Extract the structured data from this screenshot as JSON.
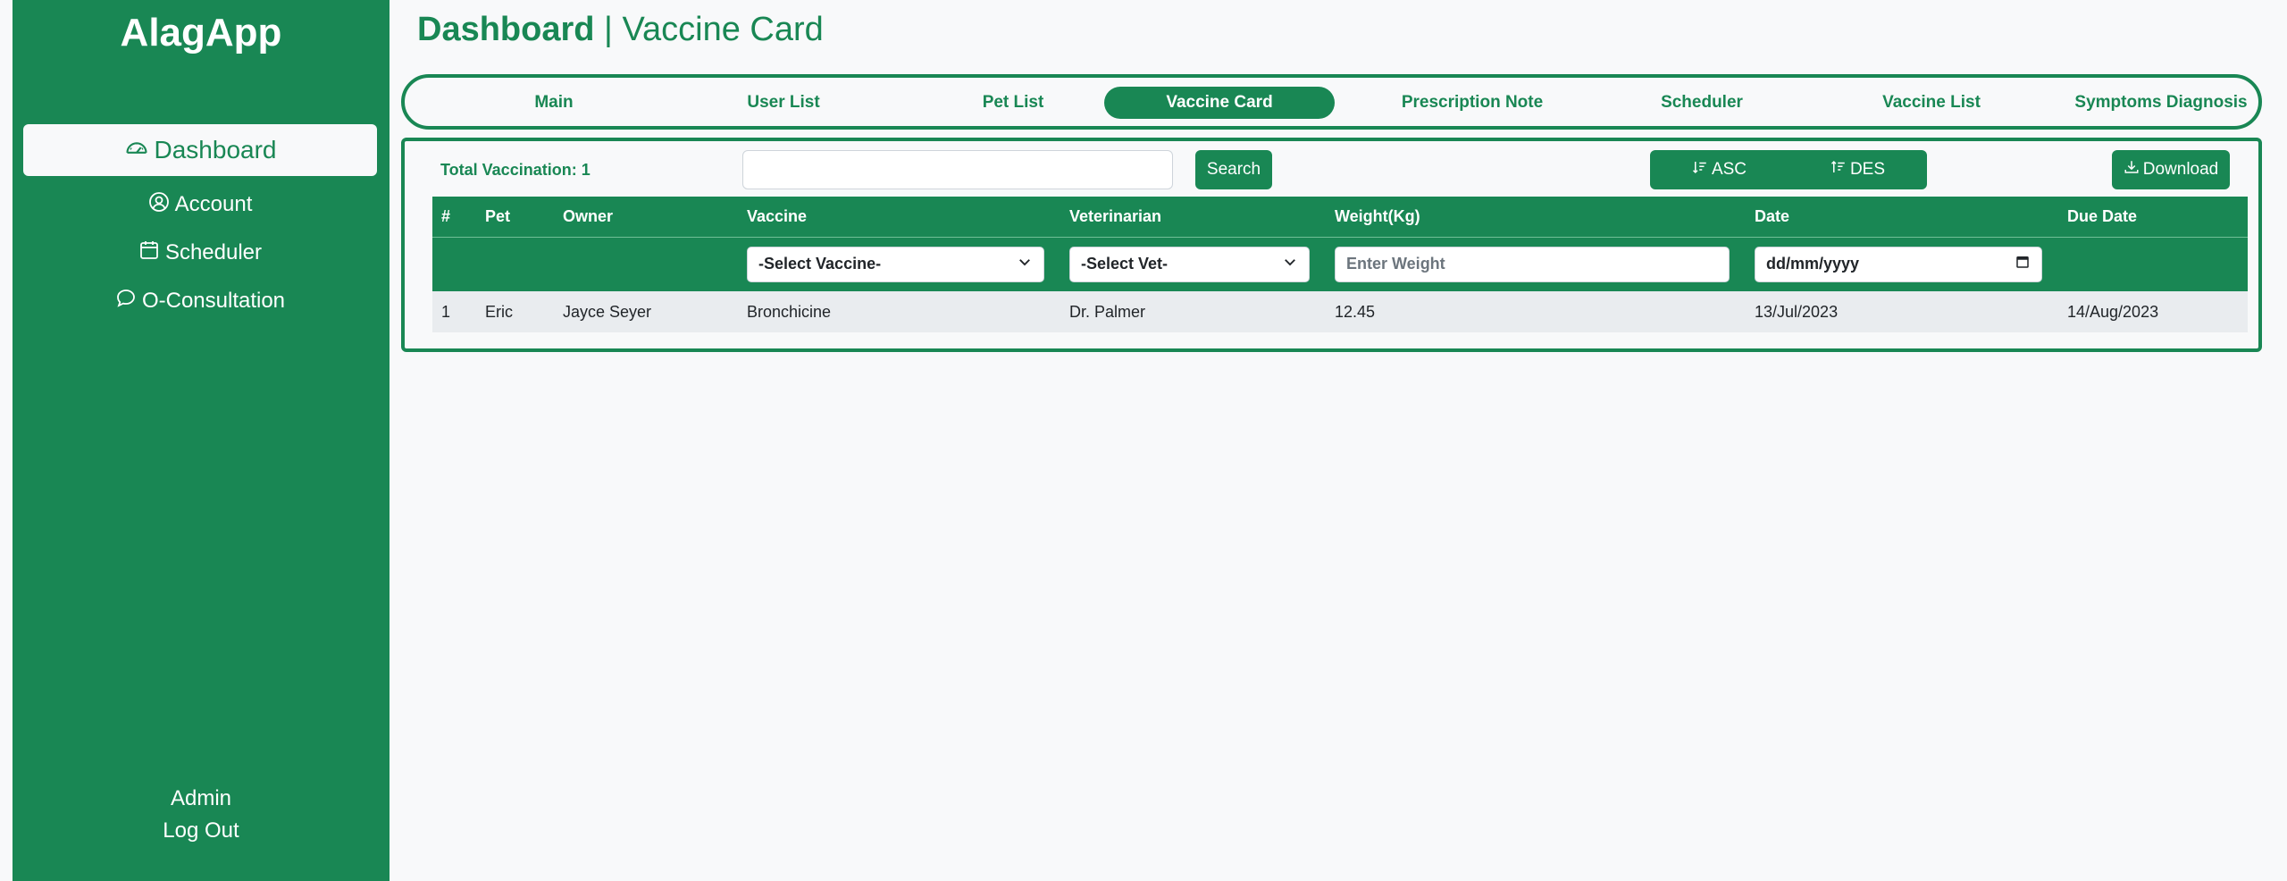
{
  "sidebar": {
    "brand": "AlagApp",
    "items": [
      {
        "label": "Dashboard",
        "icon": "speedometer-icon",
        "active": true
      },
      {
        "label": "Account",
        "icon": "user-circle-icon",
        "active": false
      },
      {
        "label": "Scheduler",
        "icon": "calendar-icon",
        "active": false
      },
      {
        "label": "O-Consultation",
        "icon": "chat-bubble-icon",
        "active": false
      }
    ],
    "user_role": "Admin",
    "logout": "Log Out"
  },
  "header": {
    "title_bold": "Dashboard",
    "title_rest": " | Vaccine Card"
  },
  "tabs": [
    {
      "label": "Main",
      "active": false
    },
    {
      "label": "User List",
      "active": false
    },
    {
      "label": "Pet List",
      "active": false
    },
    {
      "label": "Vaccine Card",
      "active": true
    },
    {
      "label": "Prescription Note",
      "active": false
    },
    {
      "label": "Scheduler",
      "active": false
    },
    {
      "label": "Vaccine List",
      "active": false
    },
    {
      "label": "Symptoms Diagnosis",
      "active": false
    }
  ],
  "toolbar": {
    "total": "Total Vaccination: 1",
    "search_value": "",
    "search_button": "Search",
    "asc": "ASC",
    "des": "DES",
    "download": "Download"
  },
  "table": {
    "columns": [
      "#",
      "Pet",
      "Owner",
      "Vaccine",
      "Veterinarian",
      "Weight(Kg)",
      "Date",
      "Due Date"
    ],
    "filters": {
      "vaccine": "-Select Vaccine-",
      "vet": "-Select Vet-",
      "weight_placeholder": "Enter Weight",
      "date": "dd/mm/yyyy"
    },
    "rows": [
      [
        "1",
        "Eric",
        "Jayce Seyer",
        "Bronchicine",
        "Dr. Palmer",
        "12.45",
        "13/Jul/2023",
        "14/Aug/2023"
      ]
    ]
  },
  "colors": {
    "primary": "#198754",
    "background": "#f8f9fa"
  }
}
